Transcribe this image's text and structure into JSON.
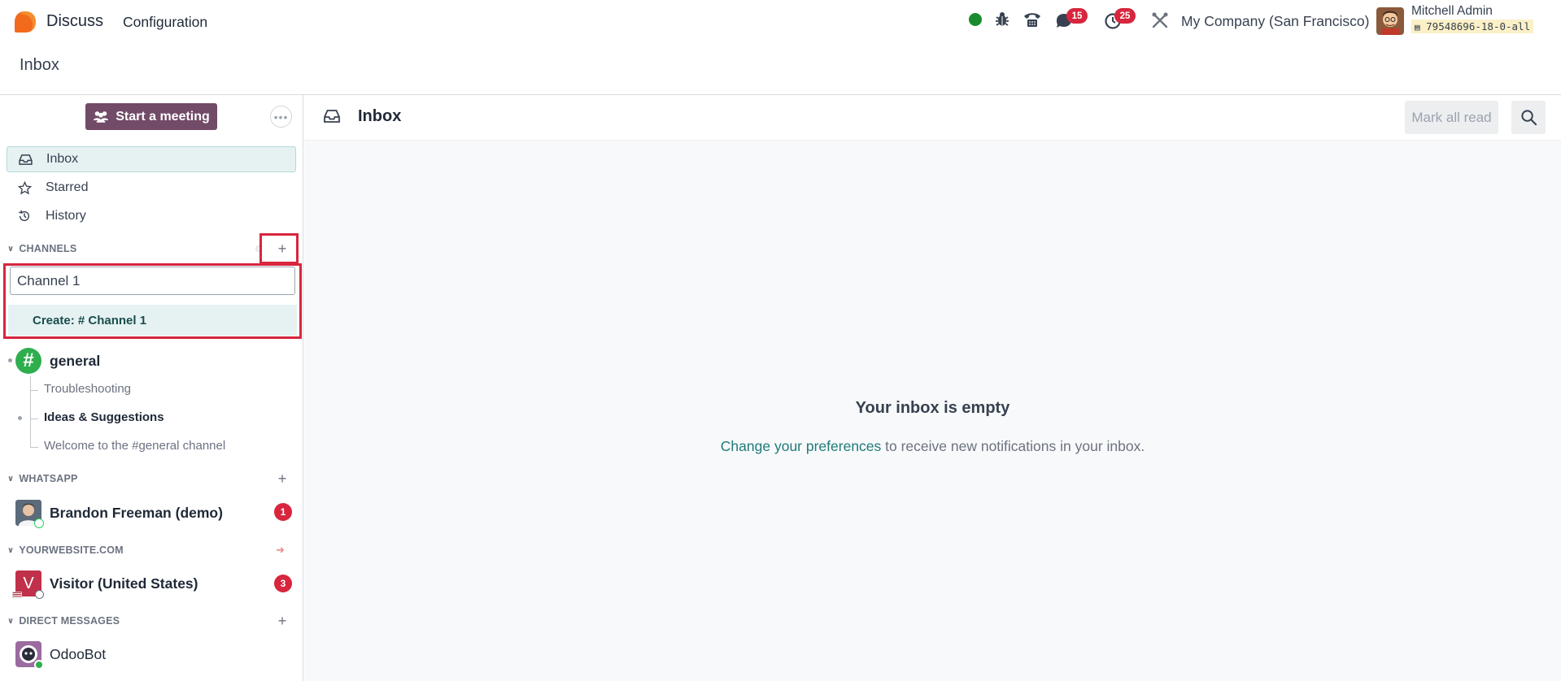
{
  "navbar": {
    "app_name": "Discuss",
    "menu_configuration": "Configuration",
    "messages_count": "15",
    "activities_count": "25",
    "company": "My Company (San Francisco)",
    "user_name": "Mitchell Admin",
    "db_name": "79548696-18-0-all"
  },
  "breadcrumb": "Inbox",
  "sidebar": {
    "meeting_label": "Start a meeting",
    "items": [
      {
        "label": "Inbox"
      },
      {
        "label": "Starred"
      },
      {
        "label": "History"
      }
    ],
    "channels_title": "CHANNELS",
    "channel_input_value": "Channel 1",
    "create_option": "Create: # Channel 1",
    "general_channel": "general",
    "sub_threads": [
      "Troubleshooting",
      "Ideas & Suggestions",
      "Welcome to the #general channel"
    ],
    "whatsapp_title": "WHATSAPP",
    "whatsapp_contact": "Brandon Freeman (demo)",
    "whatsapp_unread": "1",
    "website_title": "YOURWEBSITE.COM",
    "visitor_name": "Visitor (United States)",
    "visitor_initial": "V",
    "visitor_unread": "3",
    "dm_title": "DIRECT MESSAGES",
    "dm_contact": "OdooBot"
  },
  "main": {
    "title": "Inbox",
    "mark_all_read": "Mark all read",
    "empty_title": "Your inbox is empty",
    "empty_link": "Change your preferences",
    "empty_rest": " to receive new notifications in your inbox."
  },
  "colors": {
    "brand": "#714b67",
    "teal_link": "#1f7a7a",
    "badge_red": "#d7263d",
    "online_green": "#198b2e",
    "highlight_box": "#d7263d"
  }
}
